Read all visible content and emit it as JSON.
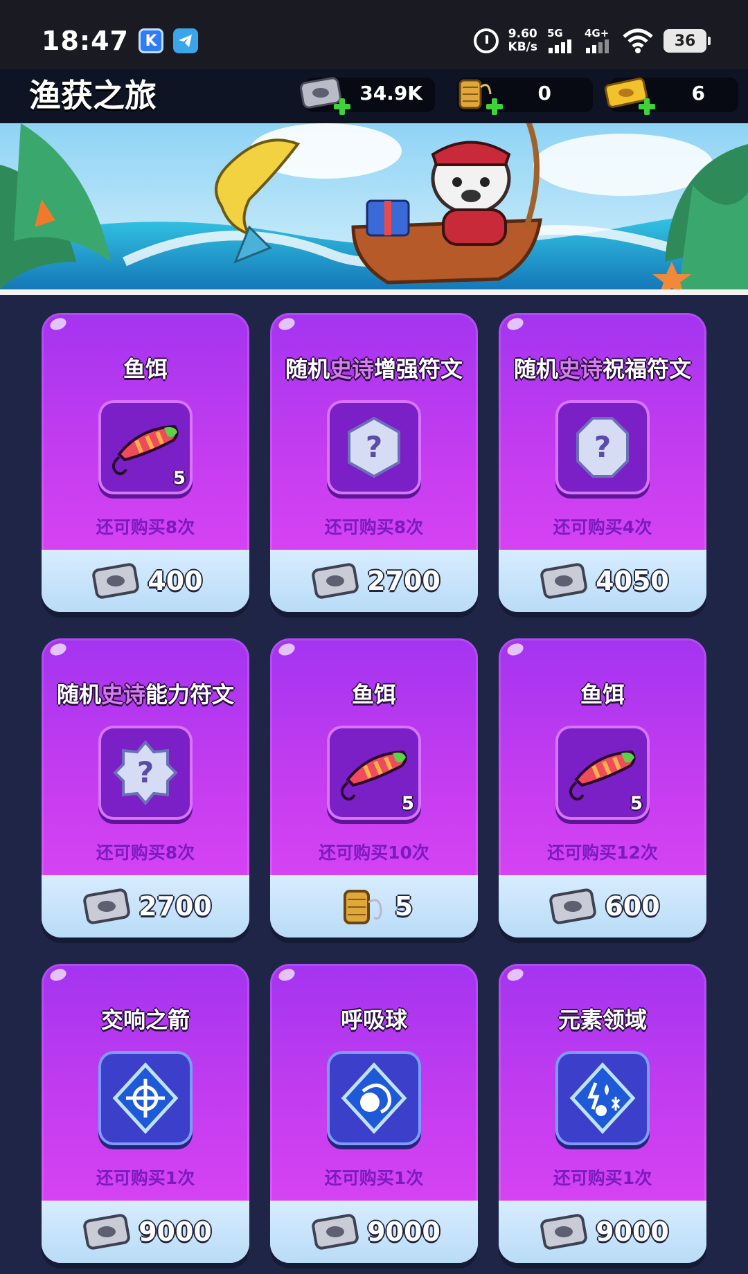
{
  "status_bar": {
    "time": "18:47",
    "net_speed_value": "9.60",
    "net_speed_unit": "KB/s",
    "network_1": "5G",
    "network_2": "4G+",
    "battery": "36"
  },
  "header": {
    "title": "渔获之旅",
    "currencies": [
      {
        "name": "fish-ticket-icon",
        "value": "34.9K"
      },
      {
        "name": "fishing-line-spool-icon",
        "value": "0"
      },
      {
        "name": "golden-ticket-icon",
        "value": "6"
      }
    ]
  },
  "colors": {
    "card_purple": "#c63df0",
    "remain_text": "#7a1ac0",
    "price_bar": "#c7e4fb",
    "background": "#1e2547"
  },
  "shop": {
    "items": [
      {
        "name_pre": "鱼饵",
        "name_epic": "",
        "name_post": "",
        "icon": "fishing-lure-icon",
        "qty": "5",
        "remain": "还可购买8次",
        "currency": "fish-ticket-icon",
        "price": "400"
      },
      {
        "name_pre": "随机",
        "name_epic": "史诗",
        "name_post": "增强符文",
        "icon": "hexagon-question-icon",
        "qty": "",
        "remain": "还可购买8次",
        "currency": "fish-ticket-icon",
        "price": "2700"
      },
      {
        "name_pre": "随机",
        "name_epic": "史诗",
        "name_post": "祝福符文",
        "icon": "octagon-question-icon",
        "qty": "",
        "remain": "还可购买4次",
        "currency": "fish-ticket-icon",
        "price": "4050"
      },
      {
        "name_pre": "随机",
        "name_epic": "史诗",
        "name_post": "能力符文",
        "icon": "star-question-icon",
        "qty": "",
        "remain": "还可购买8次",
        "currency": "fish-ticket-icon",
        "price": "2700"
      },
      {
        "name_pre": "鱼饵",
        "name_epic": "",
        "name_post": "",
        "icon": "fishing-lure-icon",
        "qty": "5",
        "remain": "还可购买10次",
        "currency": "fishing-line-spool-icon",
        "price": "5"
      },
      {
        "name_pre": "鱼饵",
        "name_epic": "",
        "name_post": "",
        "icon": "fishing-lure-icon",
        "qty": "5",
        "remain": "还可购买12次",
        "currency": "fish-ticket-icon",
        "price": "600"
      },
      {
        "name_pre": "交响之箭",
        "name_epic": "",
        "name_post": "",
        "icon": "compass-rune-icon",
        "qty": "",
        "remain": "还可购买1次",
        "currency": "fish-ticket-icon",
        "price": "9000"
      },
      {
        "name_pre": "呼吸球",
        "name_epic": "",
        "name_post": "",
        "icon": "spiral-orb-rune-icon",
        "qty": "",
        "remain": "还可购买1次",
        "currency": "fish-ticket-icon",
        "price": "9000"
      },
      {
        "name_pre": "元素领域",
        "name_epic": "",
        "name_post": "",
        "icon": "elements-rune-icon",
        "qty": "",
        "remain": "还可购买1次",
        "currency": "fish-ticket-icon",
        "price": "9000"
      }
    ]
  }
}
